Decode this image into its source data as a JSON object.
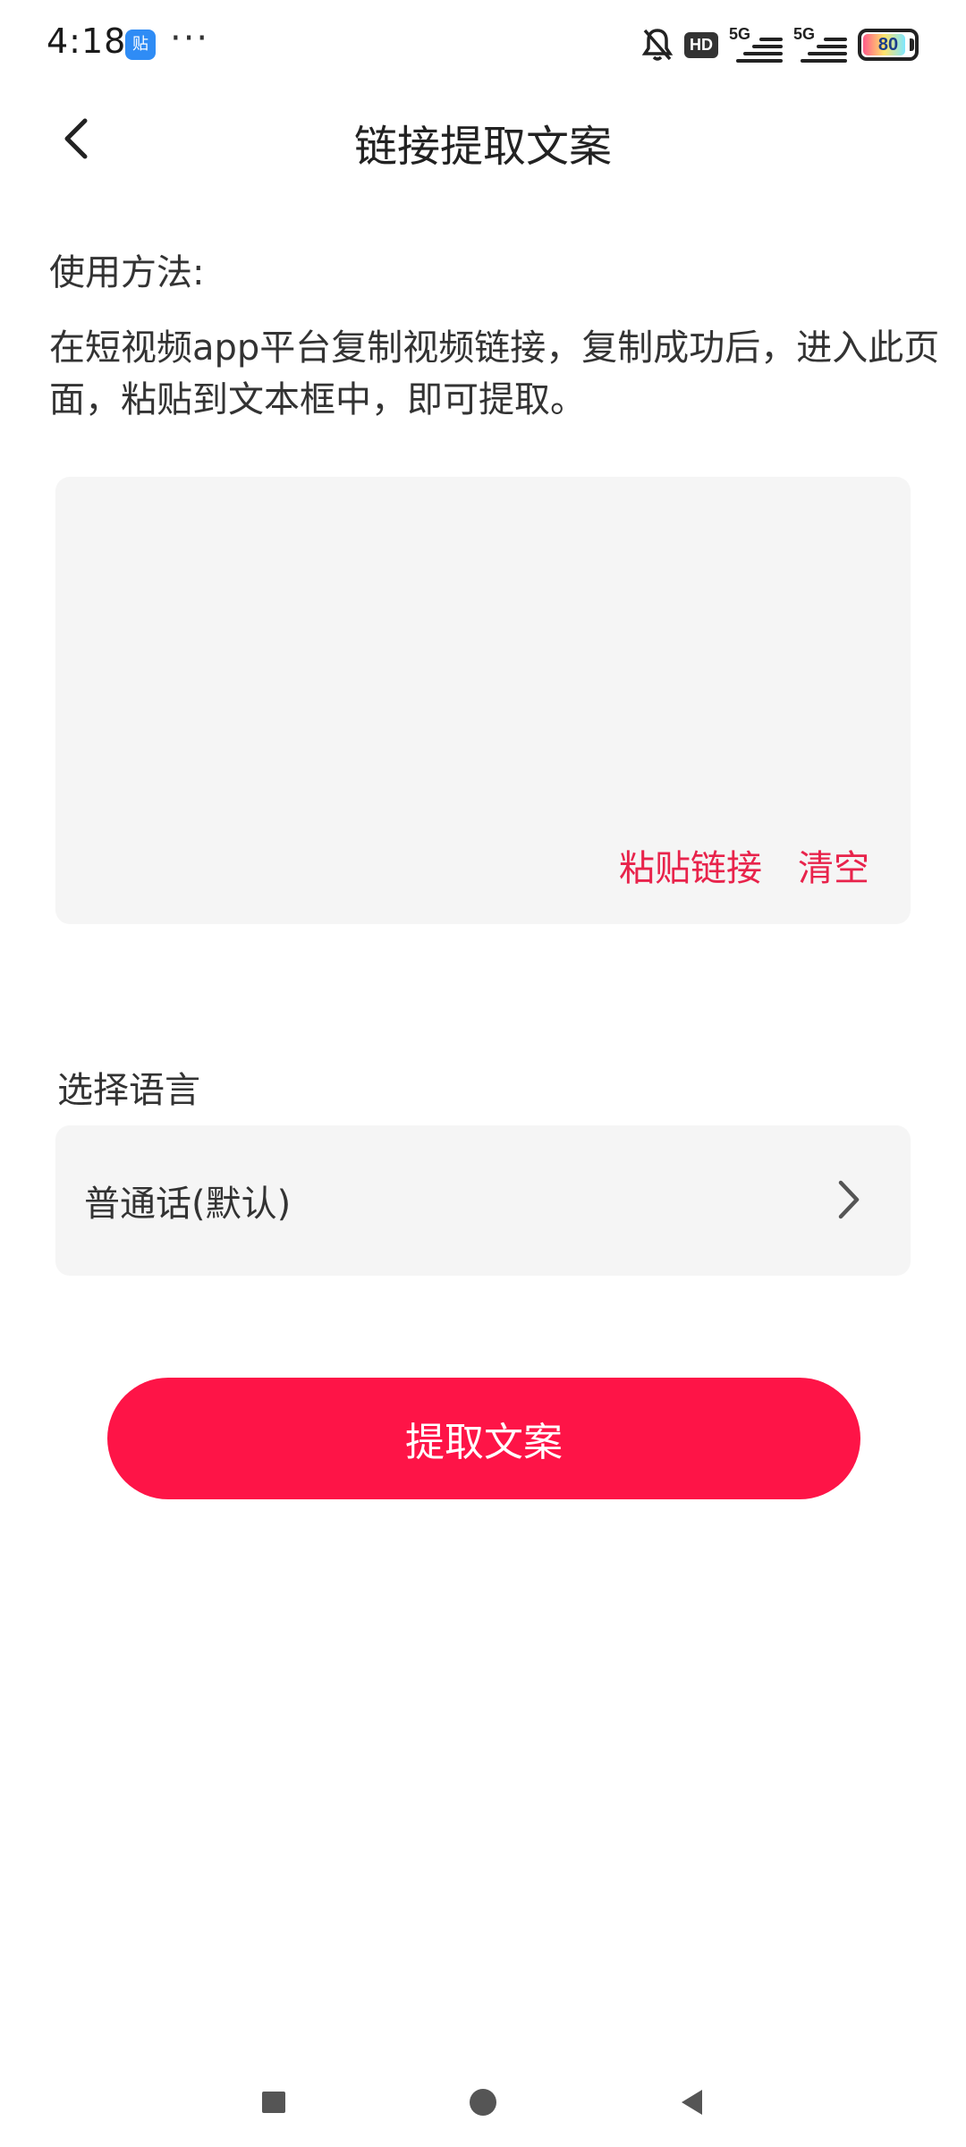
{
  "status_bar": {
    "time": "4:18",
    "notification_app_icon": "贴",
    "more_indicator": "···",
    "hd_badge": "HD",
    "signal_label_1": "5G",
    "signal_label_2": "5G",
    "battery_level": "80",
    "icons": [
      "mute-bell-icon",
      "hd-voice-icon",
      "signal-5g-icon",
      "signal-5g-icon",
      "battery-icon"
    ]
  },
  "header": {
    "title": "链接提取文案",
    "back_icon": "chevron-left-icon"
  },
  "instructions": {
    "heading": "使用方法:",
    "body": "在短视频app平台复制视频链接，复制成功后，进入此页面，粘贴到文本框中，即可提取。"
  },
  "link_input": {
    "value": "",
    "paste_label": "粘贴链接",
    "clear_label": "清空"
  },
  "language": {
    "label": "选择语言",
    "selected": "普通话(默认)",
    "chevron_icon": "chevron-right-icon"
  },
  "submit": {
    "label": "提取文案"
  },
  "colors": {
    "accent": "#fe1447",
    "action_text": "#e8234b",
    "card_background": "#f5f5f5"
  },
  "nav_bar": {
    "icons": [
      "recent-apps-icon",
      "home-icon",
      "back-icon"
    ]
  }
}
